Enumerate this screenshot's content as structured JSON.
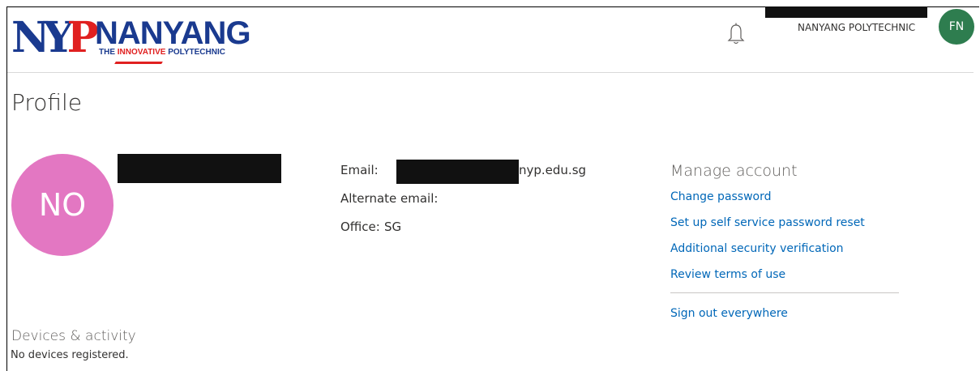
{
  "topbar": {
    "logo_word": "NANYANG",
    "logo_tag_red": "INNOVATIVE",
    "logo_tag_pre": "THE ",
    "logo_tag_post": " POLYTECHNIC",
    "logo_ny": "NY",
    "logo_p": "P",
    "org_name": "NANYANG POLYTECHNIC",
    "user_initials": "FN"
  },
  "page": {
    "title": "Profile"
  },
  "profile": {
    "initials": "NO",
    "email_label": "Email:",
    "email_suffix": "nyp.edu.sg",
    "alt_email_label": "Alternate email:",
    "office_label": "Office:",
    "office_value": "SG"
  },
  "manage": {
    "title": "Manage account",
    "links": [
      "Change password",
      "Set up self service password reset",
      "Additional security verification",
      "Review terms of use"
    ],
    "sign_out": "Sign out everywhere"
  },
  "devices": {
    "title": "Devices & activity",
    "status": "No devices registered."
  },
  "colors": {
    "link": "#0067b8",
    "avatar_large": "#e377c2",
    "avatar_small": "#2e7d4f",
    "brand_blue": "#1a3a8f",
    "brand_red": "#e02020"
  }
}
